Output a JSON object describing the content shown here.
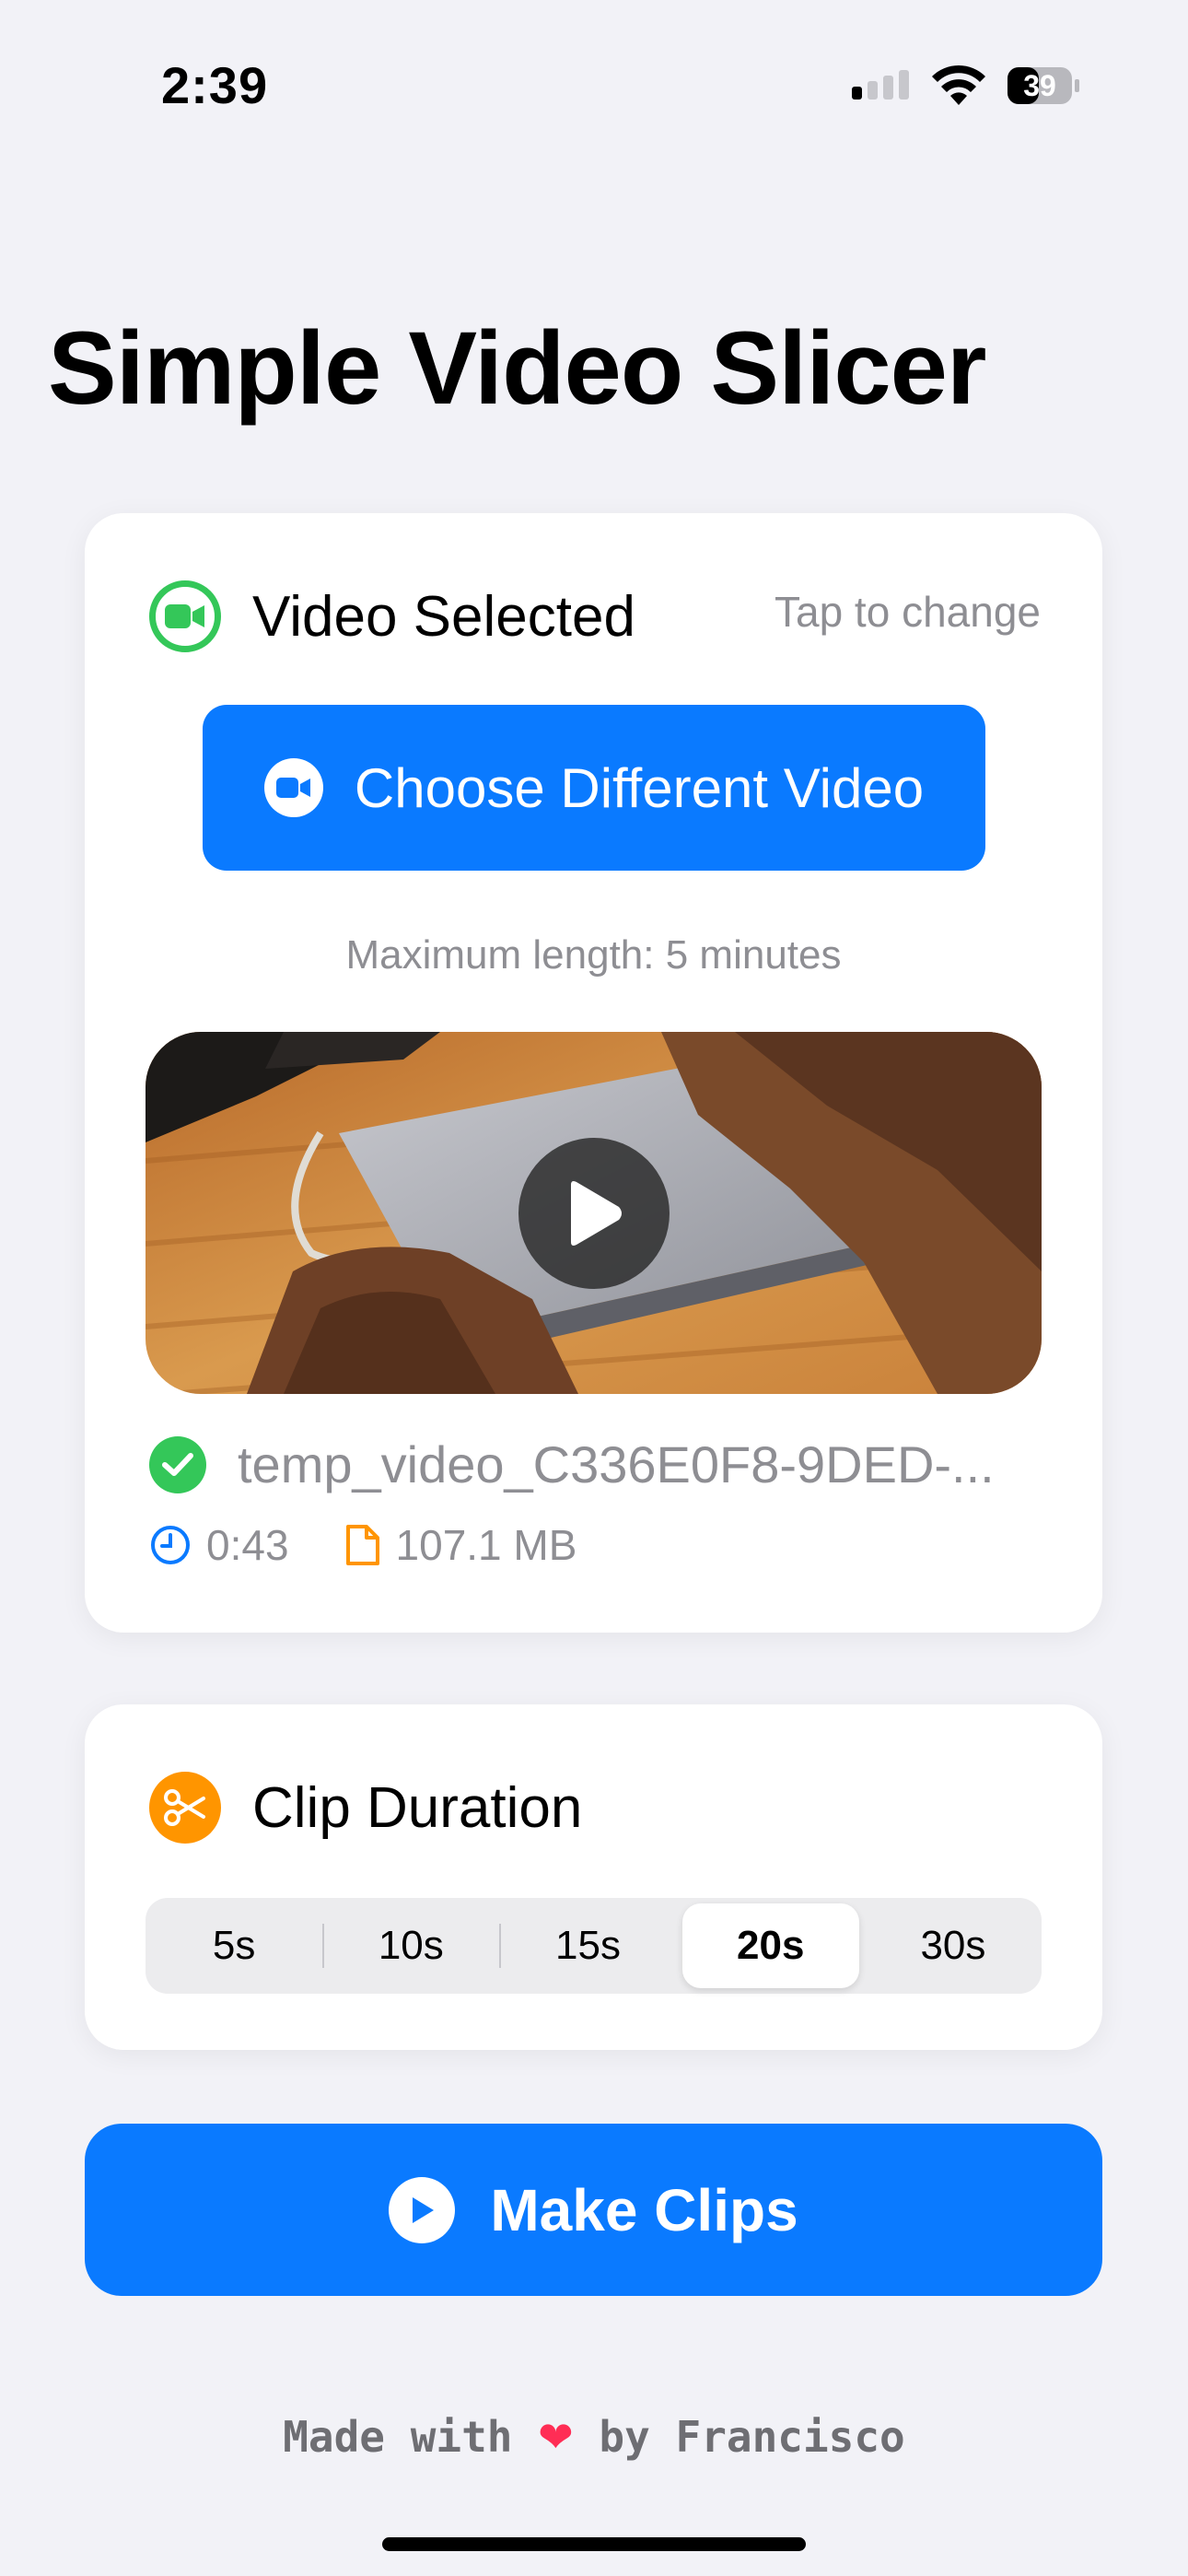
{
  "status_bar": {
    "time": "2:39",
    "battery": "39"
  },
  "app": {
    "title": "Simple Video Slicer"
  },
  "video_card": {
    "header_title": "Video Selected",
    "tap_hint": "Tap to change",
    "choose_button_label": "Choose Different Video",
    "max_length_text": "Maximum length: 5 minutes",
    "file_name": "temp_video_C336E0F8-9DED-...",
    "duration": "0:43",
    "size": "107.1 MB"
  },
  "clip_card": {
    "header_title": "Clip Duration",
    "options": [
      "5s",
      "10s",
      "15s",
      "20s",
      "30s"
    ],
    "selected": "20s"
  },
  "make_clips_label": "Make Clips",
  "footer": {
    "prefix": "Made with",
    "heart": "❤",
    "suffix": "by Francisco"
  },
  "colors": {
    "accent": "#0a7aff",
    "success": "#34c759",
    "orange": "#ff9500",
    "heart": "#ff2d55"
  }
}
